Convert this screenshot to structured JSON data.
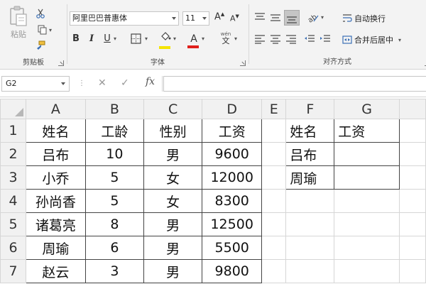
{
  "ribbon": {
    "clipboard": {
      "paste_label": "粘贴",
      "group_label": "剪贴板"
    },
    "font": {
      "font_name": "阿里巴巴普惠体",
      "font_size": "11",
      "group_label": "字体",
      "bold": "B",
      "italic": "I",
      "underline": "U",
      "wen": "wén"
    },
    "alignment": {
      "group_label": "对齐方式",
      "wrap_text": "自动换行",
      "merge_center": "合并后居中"
    },
    "colors": {
      "fill": "#f5e400",
      "font": "#e0201b",
      "paste_icon": "#b0b0b0"
    }
  },
  "formula_bar": {
    "name_box": "G2",
    "fx": "fx",
    "value": ""
  },
  "grid": {
    "columns": [
      "A",
      "B",
      "C",
      "D",
      "E",
      "F",
      "G"
    ],
    "rows": [
      "1",
      "2",
      "3",
      "4",
      "5",
      "6",
      "7"
    ],
    "table1": {
      "headers": [
        "姓名",
        "工龄",
        "性别",
        "工资"
      ],
      "records": [
        [
          "吕布",
          "10",
          "男",
          "9600"
        ],
        [
          "小乔",
          "5",
          "女",
          "12000"
        ],
        [
          "孙尚香",
          "5",
          "女",
          "8300"
        ],
        [
          "诸葛亮",
          "8",
          "男",
          "12500"
        ],
        [
          "周瑜",
          "6",
          "男",
          "5500"
        ],
        [
          "赵云",
          "3",
          "男",
          "9800"
        ]
      ]
    },
    "table2": {
      "headers": [
        "姓名",
        "工资"
      ],
      "records": [
        [
          "吕布",
          ""
        ],
        [
          "周瑜",
          ""
        ]
      ]
    }
  }
}
